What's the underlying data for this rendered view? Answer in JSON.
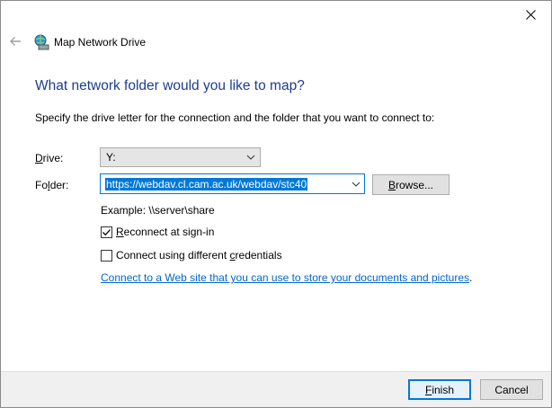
{
  "wizard": {
    "title": "Map Network Drive",
    "heading": "What network folder would you like to map?",
    "instructions": "Specify the drive letter for the connection and the folder that you want to connect to:"
  },
  "drive": {
    "label_prefix": "",
    "label_accel": "D",
    "label_rest": "rive:",
    "value": "Y:"
  },
  "folder": {
    "label_prefix": "Fo",
    "label_accel": "l",
    "label_rest": "der:",
    "value": "https://webdav.cl.cam.ac.uk/webdav/stc40"
  },
  "browse": {
    "label_accel": "B",
    "label_rest": "rowse..."
  },
  "example": "Example: \\\\server\\share",
  "reconnect": {
    "checked": true,
    "label_accel": "R",
    "label_rest": "econnect at sign-in"
  },
  "credentials": {
    "checked": false,
    "label_prefix": "Connect using different ",
    "label_accel": "c",
    "label_rest": "redentials"
  },
  "web_link": {
    "text": "Connect to a Web site that you can use to store your documents and pictures",
    "trailing": "."
  },
  "footer": {
    "finish": {
      "label_accel": "F",
      "label_rest": "inish"
    },
    "cancel": "Cancel"
  },
  "colors": {
    "accent": "#0078d7",
    "heading": "#1e3d8e",
    "link": "#0066cc"
  },
  "icons": {
    "close": "close-icon",
    "back": "back-arrow-icon",
    "wizard": "network-drive-icon"
  }
}
